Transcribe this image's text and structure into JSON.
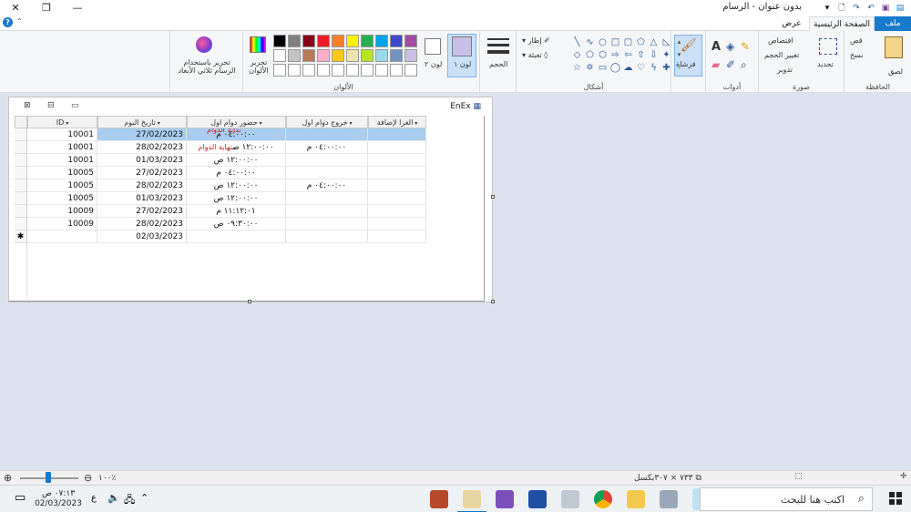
{
  "window": {
    "title": "بدون عنوان - الرسام",
    "close": "✕",
    "maximize": "❐",
    "minimize": "—"
  },
  "tabs": {
    "file": "ملف",
    "home": "الصفحة الرئيسية",
    "view": "عرض"
  },
  "help": "?",
  "ribbon": {
    "clipboard": {
      "label": "الحافظة",
      "paste": "لصق",
      "cut": "قص",
      "copy": "نسخ"
    },
    "image": {
      "label": "صورة",
      "select": "تحديد",
      "crop": "اقتصاص",
      "resize": "تغيير الحجم",
      "rotate": "تدوير"
    },
    "tools": {
      "label": "أدوات"
    },
    "brushes": {
      "label": "فرشاة"
    },
    "shapes": {
      "label": "أشكال",
      "outline": "إطار",
      "fill": "تعبئة"
    },
    "size": {
      "label": "الحجم"
    },
    "color1": {
      "label": "لون ١"
    },
    "color2": {
      "label": "لون ٢"
    },
    "colors": {
      "label": "الألوان",
      "edit": "تحرير الألوان"
    },
    "paint3d": {
      "label": "تحرير باستخدام الرسام ثلاثي الأبعاد"
    },
    "palette": [
      "#000000",
      "#7f7f7f",
      "#880015",
      "#ed1c24",
      "#ff7f27",
      "#fff200",
      "#22b14c",
      "#00a2e8",
      "#3f48cc",
      "#a349a4",
      "#ffffff",
      "#c3c3c3",
      "#b97a57",
      "#ffaec9",
      "#ffc90e",
      "#efe4b0",
      "#b5e61d",
      "#99d9ea",
      "#7092be",
      "#c8bfe7",
      "#ffffff",
      "#ffffff",
      "#ffffff",
      "#ffffff",
      "#ffffff",
      "#ffffff",
      "#ffffff",
      "#ffffff",
      "#ffffff",
      "#ffffff"
    ]
  },
  "form": {
    "title": "EnEx",
    "columns": {
      "status": "الغزا لإضافة",
      "exit": "خروج دوام اول",
      "enter": "حضور دوام اول",
      "date": "تاريخ اليوم",
      "id": "ID"
    },
    "rows": [
      {
        "id": "10001",
        "date": "27/02/2023",
        "enter": "٠٤:٠٠:٠٠ م",
        "note": "بداية الدوام",
        "exit": ""
      },
      {
        "id": "10001",
        "date": "28/02/2023",
        "enter": "١٢:٠٠:٠٠ ص",
        "note": "نهاية الدوام",
        "exit": "٠٤:٠٠:٠٠ م"
      },
      {
        "id": "10001",
        "date": "01/03/2023",
        "enter": "١٢:٠٠:٠٠ ص",
        "note": "",
        "exit": ""
      },
      {
        "id": "10005",
        "date": "27/02/2023",
        "enter": "٠٤:٠٠:٠٠ م",
        "note": "",
        "exit": ""
      },
      {
        "id": "10005",
        "date": "28/02/2023",
        "enter": "١٢:٠٠:٠٠ ص",
        "note": "",
        "exit": "٠٤:٠٠:٠٠ م"
      },
      {
        "id": "10005",
        "date": "01/03/2023",
        "enter": "١٢:٠٠:٠٠ ص",
        "note": "",
        "exit": ""
      },
      {
        "id": "10009",
        "date": "27/02/2023",
        "enter": "١١:١٢:٠١ م",
        "note": "",
        "exit": ""
      },
      {
        "id": "10009",
        "date": "28/02/2023",
        "enter": "٠٩:٣٠:٠٠ ص",
        "note": "",
        "exit": ""
      }
    ],
    "new_row": {
      "marker": "✱",
      "date": "02/03/2023"
    }
  },
  "status": {
    "zoom": "١٠٠٪",
    "size": "٧٣٣ × ٣٠٧بكسل"
  },
  "taskbar": {
    "search_placeholder": "اكتب هنا للبحث",
    "time": "٠٧:١٣ ص",
    "date": "02/03/2023",
    "lang": "ع"
  }
}
